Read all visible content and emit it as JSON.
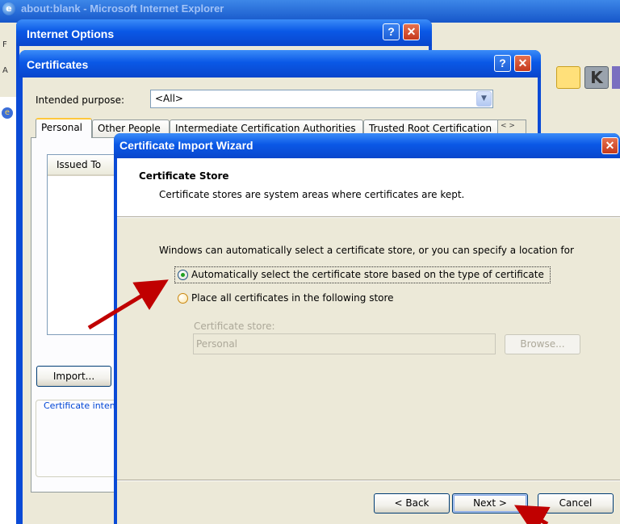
{
  "ie_window": {
    "title": "about:blank - Microsoft Internet Explorer",
    "logo_glyph": "e",
    "side_letter_1": "F",
    "side_letter_2": "A"
  },
  "internet_options": {
    "title": "Internet Options",
    "help_glyph": "?",
    "close_glyph": "✕"
  },
  "certificates": {
    "title": "Certificates",
    "help_glyph": "?",
    "close_glyph": "✕",
    "intended_purpose_label": "Intended purpose:",
    "intended_purpose_value": "<All>",
    "tabs": [
      "Personal",
      "Other People",
      "Intermediate Certification Authorities",
      "Trusted Root Certification"
    ],
    "tab_scroll": "< >",
    "list_header": "Issued To",
    "import_button": "Import...",
    "purposes_legend": "Certificate intended purposes"
  },
  "wizard": {
    "title": "Certificate Import Wizard",
    "close_glyph": "✕",
    "heading": "Certificate Store",
    "subheading": "Certificate stores are system areas where certificates are kept.",
    "intro": "Windows can automatically select a certificate store, or you can specify a location for",
    "option_auto": "Automatically select the certificate store based on the type of certificate",
    "option_place": "Place all certificates in the following store",
    "store_label": "Certificate store:",
    "store_value": "Personal",
    "browse_button": "Browse...",
    "back_button": "< Back",
    "next_button": "Next >",
    "cancel_button": "Cancel",
    "selected_option": "auto"
  },
  "colors": {
    "titlebar_blue": "#0a58e6",
    "dialog_face": "#ece9d8",
    "annotation_arrow": "#c00000"
  }
}
